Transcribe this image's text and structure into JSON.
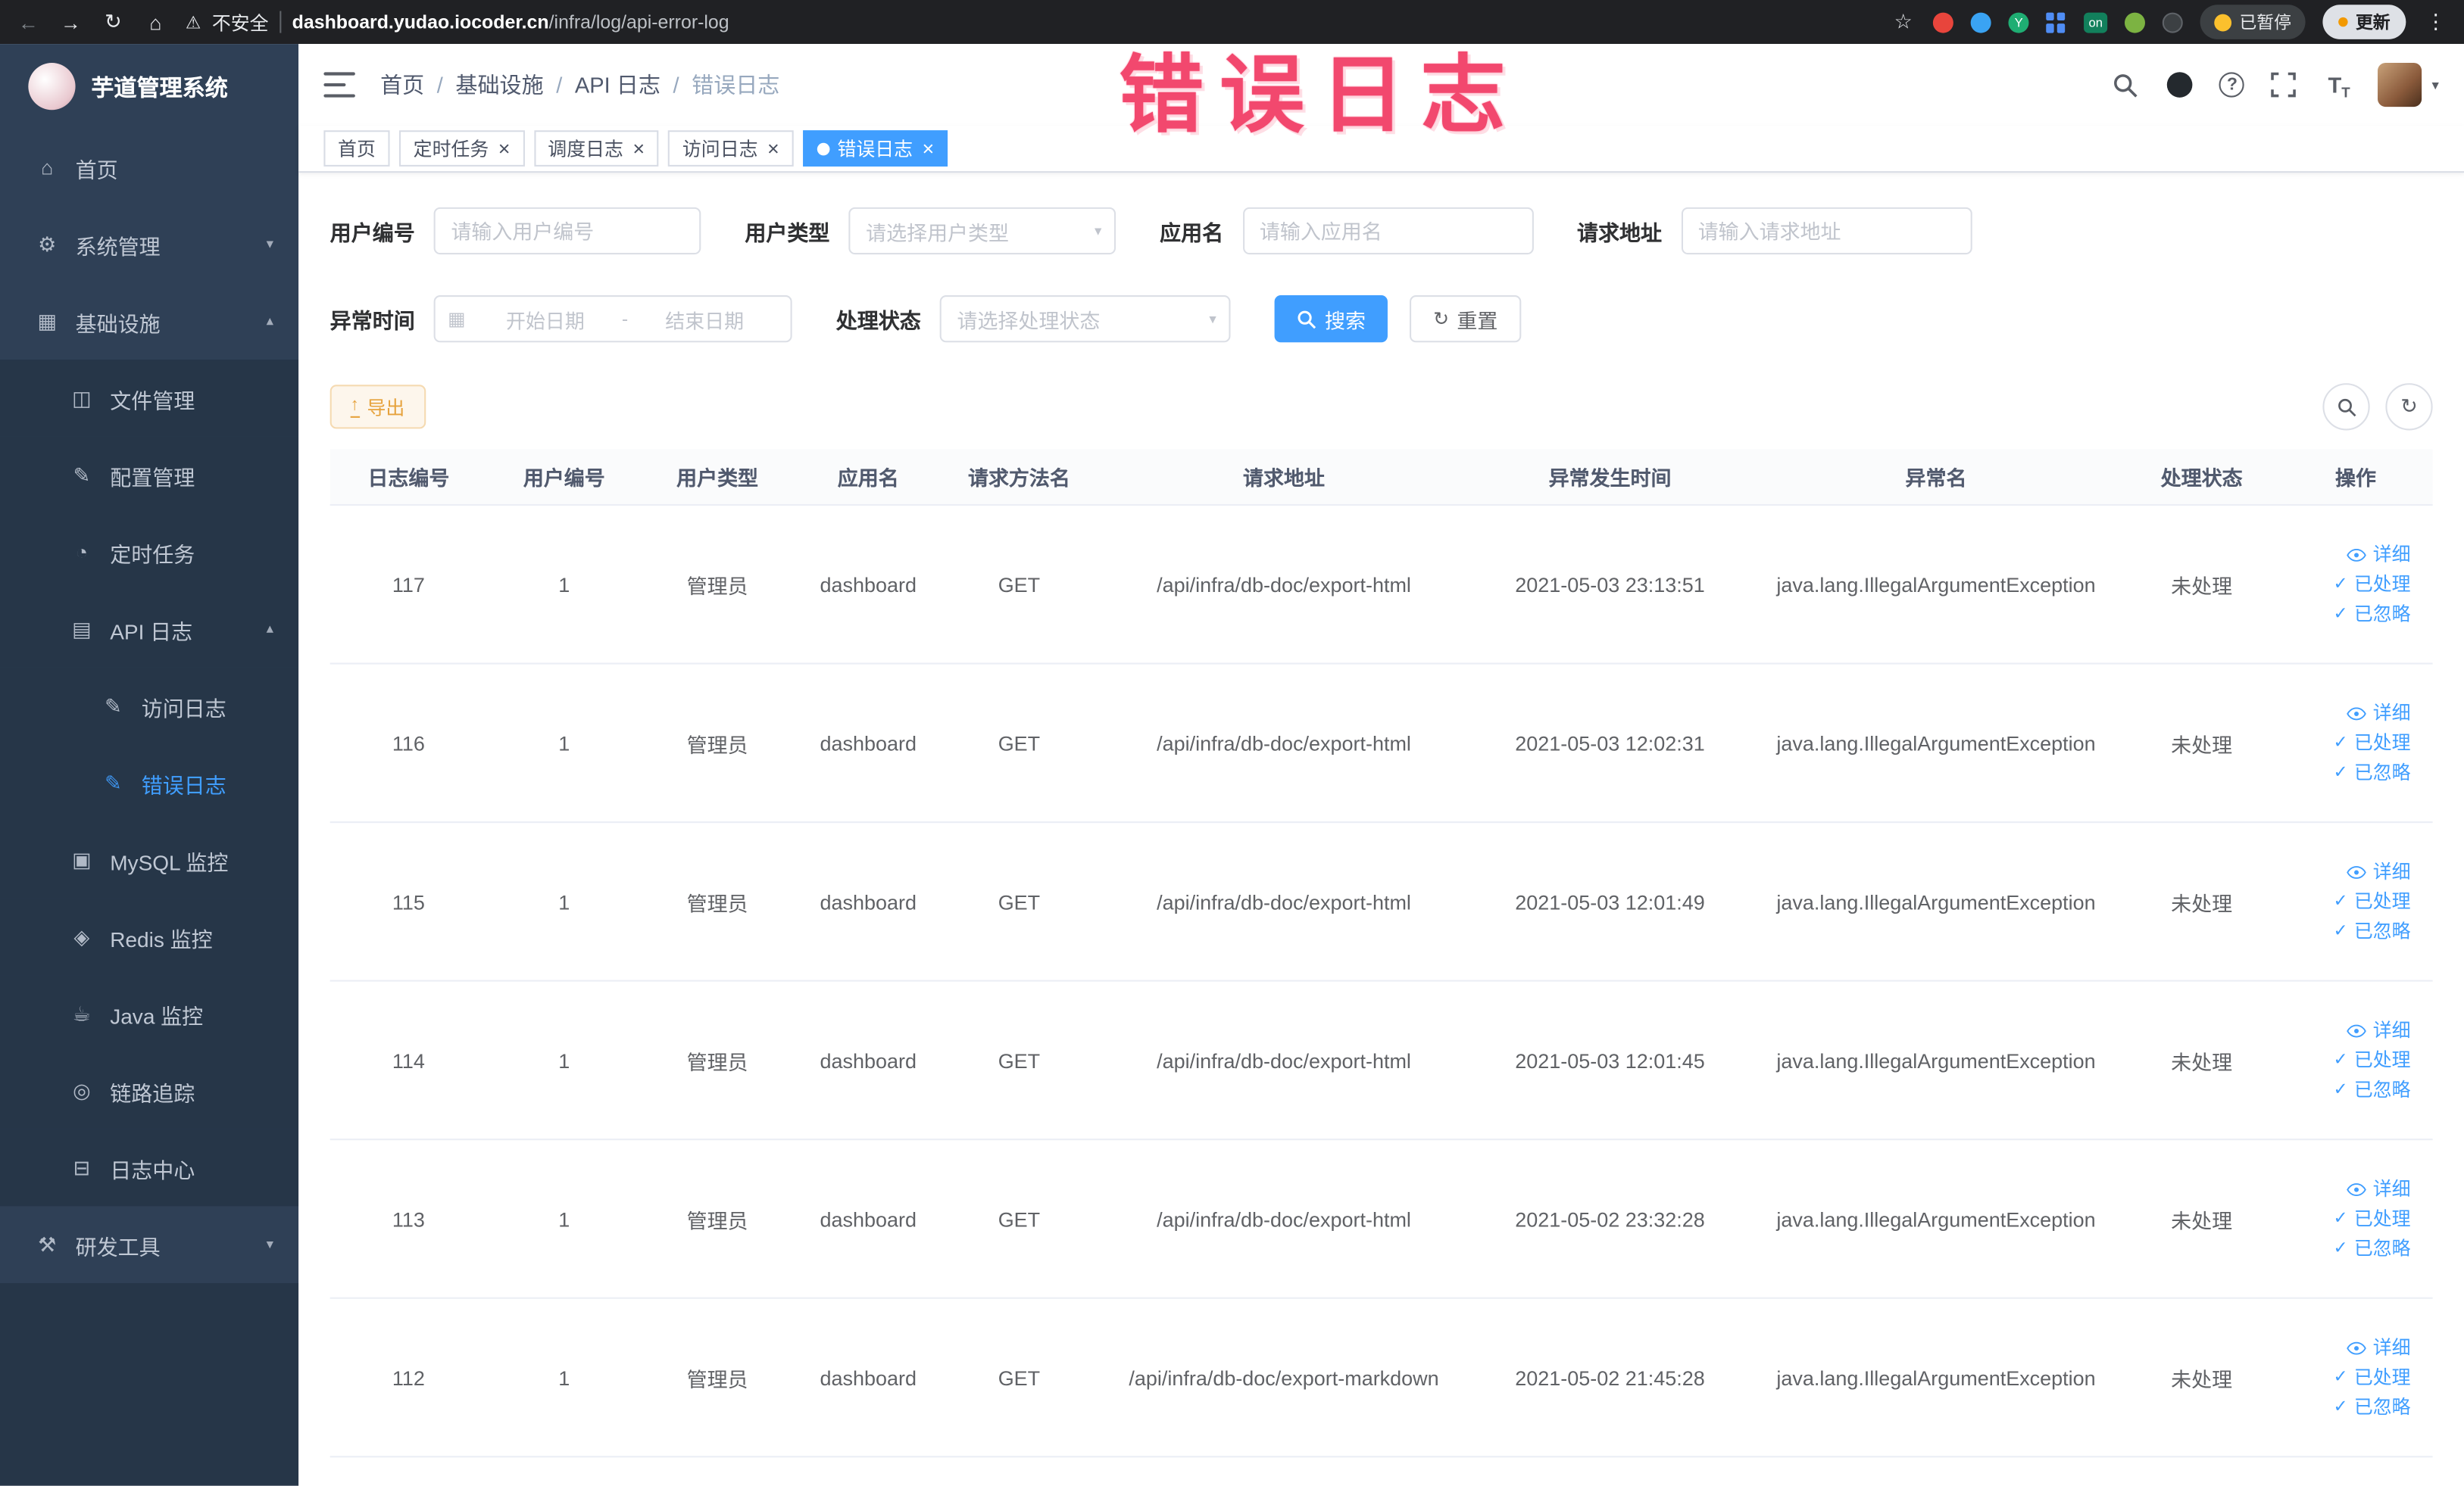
{
  "annotation": {
    "text": "错误日志"
  },
  "browser": {
    "security_label": "不安全",
    "url_domain": "dashboard.yudao.iocoder.cn",
    "url_path": "/infra/log/api-error-log",
    "extension_on_badge": "on",
    "paused_badge": "已暂停",
    "update_button": "更新"
  },
  "sidebar": {
    "title": "芋道管理系统",
    "items": [
      {
        "name": "home",
        "label": "首页",
        "icon": "home-icon",
        "level": 0
      },
      {
        "name": "system-mgmt",
        "label": "系统管理",
        "icon": "gear-icon",
        "level": 0,
        "chevron": "down"
      },
      {
        "name": "infrastructure",
        "label": "基础设施",
        "icon": "infra-icon",
        "level": 0,
        "chevron": "up"
      },
      {
        "name": "file-mgmt",
        "label": "文件管理",
        "icon": "file-icon",
        "level": 1
      },
      {
        "name": "config-mgmt",
        "label": "配置管理",
        "icon": "config-icon",
        "level": 1
      },
      {
        "name": "scheduled-tasks",
        "label": "定时任务",
        "icon": "timer-icon",
        "level": 1
      },
      {
        "name": "api-logs",
        "label": "API 日志",
        "icon": "api-log-icon",
        "level": 1,
        "chevron": "up"
      },
      {
        "name": "access-log",
        "label": "访问日志",
        "icon": "access-log-icon",
        "level": 2
      },
      {
        "name": "error-log",
        "label": "错误日志",
        "icon": "error-log-icon",
        "level": 2,
        "active": true
      },
      {
        "name": "mysql-monitor",
        "label": "MySQL 监控",
        "icon": "mysql-icon",
        "level": 1
      },
      {
        "name": "redis-monitor",
        "label": "Redis 监控",
        "icon": "redis-icon",
        "level": 1
      },
      {
        "name": "java-monitor",
        "label": "Java 监控",
        "icon": "java-icon",
        "level": 1
      },
      {
        "name": "trace",
        "label": "链路追踪",
        "icon": "trace-icon",
        "level": 1
      },
      {
        "name": "log-center",
        "label": "日志中心",
        "icon": "log-center-icon",
        "level": 1
      },
      {
        "name": "dev-tools",
        "label": "研发工具",
        "icon": "devtools-icon",
        "level": 0,
        "chevron": "down"
      }
    ]
  },
  "header": {
    "breadcrumb": [
      "首页",
      "基础设施",
      "API 日志",
      "错误日志"
    ]
  },
  "tabs": [
    {
      "name": "home",
      "label": "首页",
      "closable": false
    },
    {
      "name": "scheduled-tasks",
      "label": "定时任务",
      "closable": true
    },
    {
      "name": "schedule-log",
      "label": "调度日志",
      "closable": true
    },
    {
      "name": "access-log",
      "label": "访问日志",
      "closable": true
    },
    {
      "name": "error-log",
      "label": "错误日志",
      "closable": true,
      "active": true
    }
  ],
  "filters": {
    "user_id": {
      "label": "用户编号",
      "placeholder": "请输入用户编号"
    },
    "user_type": {
      "label": "用户类型",
      "placeholder": "请选择用户类型"
    },
    "app_name": {
      "label": "应用名",
      "placeholder": "请输入应用名"
    },
    "request_url": {
      "label": "请求地址",
      "placeholder": "请输入请求地址"
    },
    "exception_time": {
      "label": "异常时间",
      "start_placeholder": "开始日期",
      "separator": "-",
      "end_placeholder": "结束日期"
    },
    "process_status": {
      "label": "处理状态",
      "placeholder": "请选择处理状态"
    },
    "search_button": "搜索",
    "reset_button": "重置"
  },
  "toolbar": {
    "export_button": "导出"
  },
  "table": {
    "columns": [
      "日志编号",
      "用户编号",
      "用户类型",
      "应用名",
      "请求方法名",
      "请求地址",
      "异常发生时间",
      "异常名",
      "处理状态",
      "操作"
    ],
    "row_keys": [
      "log_id",
      "user_id",
      "user_type",
      "app_name",
      "method",
      "url",
      "time",
      "exception",
      "status"
    ],
    "actions": [
      {
        "name": "detail",
        "label": "详细",
        "icon": "eye-icon"
      },
      {
        "name": "processed",
        "label": "已处理",
        "icon": "check-icon"
      },
      {
        "name": "ignored",
        "label": "已忽略",
        "icon": "check-icon"
      }
    ],
    "rows": [
      {
        "log_id": 117,
        "user_id": 1,
        "user_type": "管理员",
        "app_name": "dashboard",
        "method": "GET",
        "url": "/api/infra/db-doc/export-html",
        "time": "2021-05-03 23:13:51",
        "exception": "java.lang.IllegalArgumentException",
        "status": "未处理"
      },
      {
        "log_id": 116,
        "user_id": 1,
        "user_type": "管理员",
        "app_name": "dashboard",
        "method": "GET",
        "url": "/api/infra/db-doc/export-html",
        "time": "2021-05-03 12:02:31",
        "exception": "java.lang.IllegalArgumentException",
        "status": "未处理"
      },
      {
        "log_id": 115,
        "user_id": 1,
        "user_type": "管理员",
        "app_name": "dashboard",
        "method": "GET",
        "url": "/api/infra/db-doc/export-html",
        "time": "2021-05-03 12:01:49",
        "exception": "java.lang.IllegalArgumentException",
        "status": "未处理"
      },
      {
        "log_id": 114,
        "user_id": 1,
        "user_type": "管理员",
        "app_name": "dashboard",
        "method": "GET",
        "url": "/api/infra/db-doc/export-html",
        "time": "2021-05-03 12:01:45",
        "exception": "java.lang.IllegalArgumentException",
        "status": "未处理"
      },
      {
        "log_id": 113,
        "user_id": 1,
        "user_type": "管理员",
        "app_name": "dashboard",
        "method": "GET",
        "url": "/api/infra/db-doc/export-html",
        "time": "2021-05-02 23:32:28",
        "exception": "java.lang.IllegalArgumentException",
        "status": "未处理"
      },
      {
        "log_id": 112,
        "user_id": 1,
        "user_type": "管理员",
        "app_name": "dashboard",
        "method": "GET",
        "url": "/api/infra/db-doc/export-markdown",
        "time": "2021-05-02 21:45:28",
        "exception": "java.lang.IllegalArgumentException",
        "status": "未处理"
      }
    ]
  },
  "colors": {
    "primary": "#409eff",
    "warning": "#e6a23c",
    "annotation": "#f2486e",
    "sidebar_bg": "#2f4056",
    "submenu_bg": "#263648"
  },
  "icons": {
    "back-icon": "←",
    "forward-icon": "→",
    "reload-icon": "↻",
    "home-nav-icon": "⌂",
    "warning-icon": "⚠",
    "star-icon": "☆",
    "more-vert-icon": "⋮",
    "home-icon": "⌂",
    "gear-icon": "⚙",
    "infra-icon": "▦",
    "file-icon": "◫",
    "config-icon": "✎",
    "timer-icon": "◔",
    "api-log-icon": "▤",
    "access-log-icon": "✎",
    "error-log-icon": "✎",
    "mysql-icon": "▣",
    "redis-icon": "◈",
    "java-icon": "☕",
    "trace-icon": "◎",
    "log-center-icon": "⊟",
    "devtools-icon": "⚒",
    "chevron-down-icon": "▾",
    "chevron-up-icon": "▴",
    "caret-down-icon": "▾",
    "calendar-icon": "▦",
    "check-icon": "✓"
  }
}
